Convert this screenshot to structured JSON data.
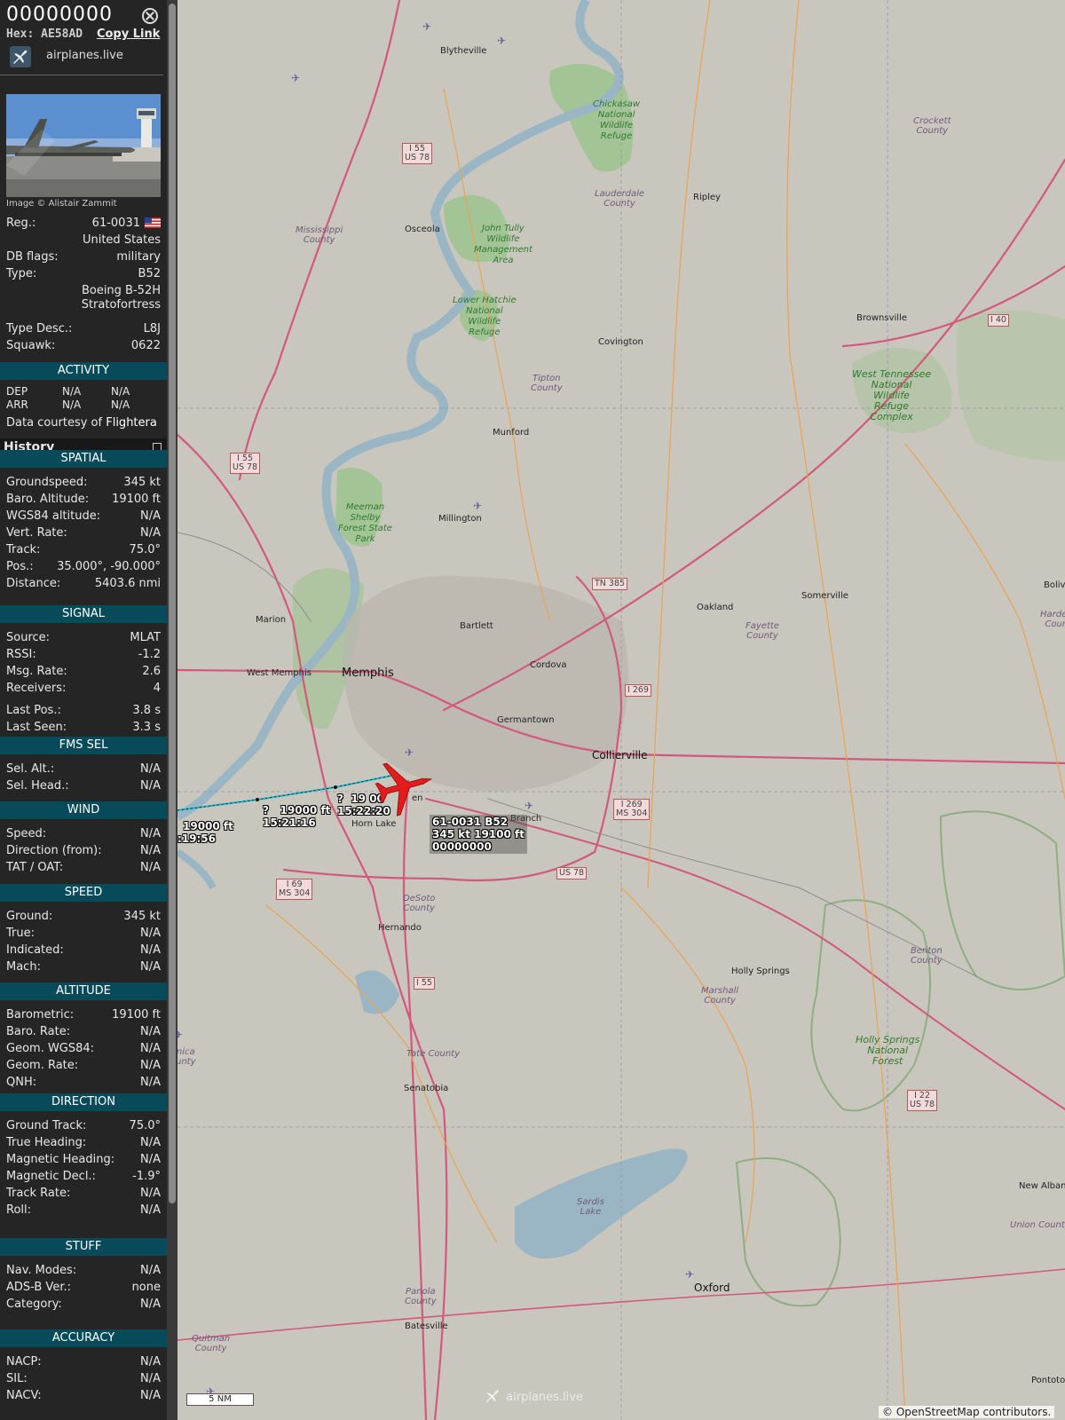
{
  "sidebar": {
    "callsign": "00000000",
    "hex_label": "Hex:",
    "hex": "AE58AD",
    "copy_link": "Copy Link",
    "brand": "airplanes.live",
    "photo_credit": "Image © Alistair Zammit",
    "reg_label": "Reg.:",
    "reg": "61-0031",
    "country": "United States",
    "dbflags_label": "DB flags:",
    "dbflags": "military",
    "type_label": "Type:",
    "type": "B52",
    "type_name_1": "Boeing B-52H",
    "type_name_2": "Stratofortress",
    "typedesc_label": "Type Desc.:",
    "typedesc": "L8J",
    "squawk_label": "Squawk:",
    "squawk": "0622",
    "activity": {
      "header": "ACTIVITY",
      "dep": "DEP",
      "dep_v1": "N/A",
      "dep_v2": "N/A",
      "arr": "ARR",
      "arr_v1": "N/A",
      "arr_v2": "N/A",
      "courtesy": "Data courtesy of",
      "courtesy_src": "Flightera"
    },
    "history": "History",
    "spatial": {
      "header": "SPATIAL",
      "rows": [
        {
          "label": "Groundspeed:",
          "value": "345 kt"
        },
        {
          "label": "Baro. Altitude:",
          "value": "19100 ft"
        },
        {
          "label": "WGS84 altitude:",
          "value": "N/A"
        },
        {
          "label": "Vert. Rate:",
          "value": "N/A"
        },
        {
          "label": "Track:",
          "value": "75.0°"
        },
        {
          "label": "Pos.:",
          "value": "35.000°, -90.000°"
        },
        {
          "label": "Distance:",
          "value": "5403.6 nmi"
        }
      ]
    },
    "signal": {
      "header": "SIGNAL",
      "rows": [
        {
          "label": "Source:",
          "value": "MLAT"
        },
        {
          "label": "RSSI:",
          "value": "-1.2"
        },
        {
          "label": "Msg. Rate:",
          "value": "2.6"
        },
        {
          "label": "Receivers:",
          "value": "4"
        },
        {
          "label": "Last Pos.:",
          "value": "3.8 s"
        },
        {
          "label": "Last Seen:",
          "value": "3.3 s"
        }
      ]
    },
    "fms": {
      "header": "FMS SEL",
      "rows": [
        {
          "label": "Sel. Alt.:",
          "value": "N/A"
        },
        {
          "label": "Sel. Head.:",
          "value": "N/A"
        }
      ]
    },
    "wind": {
      "header": "WIND",
      "rows": [
        {
          "label": "Speed:",
          "value": "N/A"
        },
        {
          "label": "Direction (from):",
          "value": "N/A"
        },
        {
          "label": "TAT / OAT:",
          "value": "N/A"
        }
      ]
    },
    "speed": {
      "header": "SPEED",
      "rows": [
        {
          "label": "Ground:",
          "value": "345 kt"
        },
        {
          "label": "True:",
          "value": "N/A"
        },
        {
          "label": "Indicated:",
          "value": "N/A"
        },
        {
          "label": "Mach:",
          "value": "N/A"
        }
      ]
    },
    "altitude": {
      "header": "ALTITUDE",
      "rows": [
        {
          "label": "Barometric:",
          "value": "19100 ft"
        },
        {
          "label": "Baro. Rate:",
          "value": "N/A"
        },
        {
          "label": "Geom. WGS84:",
          "value": "N/A"
        },
        {
          "label": "Geom. Rate:",
          "value": "N/A"
        },
        {
          "label": "QNH:",
          "value": "N/A"
        }
      ]
    },
    "direction": {
      "header": "DIRECTION",
      "rows": [
        {
          "label": "Ground Track:",
          "value": "75.0°"
        },
        {
          "label": "True Heading:",
          "value": "N/A"
        },
        {
          "label": "Magnetic Heading:",
          "value": "N/A"
        },
        {
          "label": "Magnetic Decl.:",
          "value": "-1.9°"
        },
        {
          "label": "Track Rate:",
          "value": "N/A"
        },
        {
          "label": "Roll:",
          "value": "N/A"
        }
      ]
    },
    "stuff": {
      "header": "STUFF",
      "rows": [
        {
          "label": "Nav. Modes:",
          "value": "N/A"
        },
        {
          "label": "ADS-B Ver.:",
          "value": "none"
        },
        {
          "label": "Category:",
          "value": "N/A"
        }
      ]
    },
    "accuracy": {
      "header": "ACCURACY",
      "rows": [
        {
          "label": "NACP:",
          "value": "N/A"
        },
        {
          "label": "SIL:",
          "value": "N/A"
        },
        {
          "label": "NACV:",
          "value": "N/A"
        }
      ]
    }
  },
  "map": {
    "places": {
      "blytheville": "Blytheville",
      "osceola": "Osceola",
      "ripley": "Ripley",
      "covington": "Covington",
      "brownsville": "Brownsville",
      "munford": "Munford",
      "millington": "Millington",
      "marion": "Marion",
      "bartlett": "Bartlett",
      "west_memphis": "West Memphis",
      "memphis": "Memphis",
      "cordova": "Cordova",
      "germantown": "Germantown",
      "collierville": "Collierville",
      "oakland": "Oakland",
      "somerville": "Somerville",
      "bolivar": "Boliva",
      "southaven": "en",
      "horn_lake": "Horn Lake",
      "olive_branch": "Branch",
      "hernando": "Hernando",
      "holly_springs": "Holly Springs",
      "senatobia": "Senatobia",
      "oxford": "Oxford",
      "batesville": "Batesville",
      "new_albany": "New Albany",
      "pontotoc": "Pontoto"
    },
    "counties": {
      "mississippi": "Mississippi\nCounty",
      "crockett": "Crockett\nCounty",
      "lauderdale": "Lauderdale\nCounty",
      "tipton": "Tipton\nCounty",
      "fayette": "Fayette\nCounty",
      "hardeman": "Harden\nCoun",
      "desoto": "DeSoto\nCounty",
      "marshall": "Marshall\nCounty",
      "benton": "Benton\nCounty",
      "tate": "Tate County",
      "panola": "Panola\nCounty",
      "quitman": "Quitman\nCounty",
      "union": "Union County",
      "tunica": "nica\nunty"
    },
    "parks": {
      "chickasaw": "Chickasaw\nNational\nWildlife\nRefuge",
      "tully": "John Tully\nWildlife\nManagement\nArea",
      "hatchie": "Lower Hatchie\nNational\nWildlife\nRefuge",
      "meeman": "Meeman\nShelby\nForest State\nPark",
      "west_tn": "West Tennessee\nNational\nWildlife\nRefuge\nComplex",
      "holly_nf": "Holly Springs\nNational\nForest",
      "sardis": "Sardis\nLake"
    },
    "shields": {
      "i55_us78_n": [
        "I 55",
        "US 78"
      ],
      "i55_us78_w": [
        "I 55",
        "US 78"
      ],
      "i40": [
        "I 40"
      ],
      "tn385": [
        "TN 385"
      ],
      "i269_n": [
        "I 269"
      ],
      "i269_ms304": [
        "I 269",
        "MS 304"
      ],
      "i69_ms304": [
        "I 69",
        "MS 304"
      ],
      "us78_s": [
        "US 78"
      ],
      "i55_s": [
        "I 55"
      ],
      "i22_us78": [
        "I 22",
        "US 78"
      ]
    },
    "track_labels": [
      {
        "alt": "19000 ft",
        "time": ":19:56"
      },
      {
        "alt": "19000 ft",
        "time": "15:21:16",
        "flag": "?"
      },
      {
        "alt": "19 00",
        "time": "15:22:20",
        "flag": "?"
      }
    ],
    "aircraft_info": {
      "line1": "61-0031 B52",
      "line2": "345 kt  19100 ft",
      "line3": "00000000"
    },
    "aircraft_track_deg": 75.0,
    "scale": "5 NM",
    "watermark": "airplanes.live",
    "attribution": "© OpenStreetMap contributors."
  },
  "colors": {
    "sidebar_bg": "#252525",
    "section_header": "#074b5a",
    "aircraft": "#e31b1b",
    "track_line": "#1fb3c9",
    "map_bg": "#c9c6bd"
  }
}
